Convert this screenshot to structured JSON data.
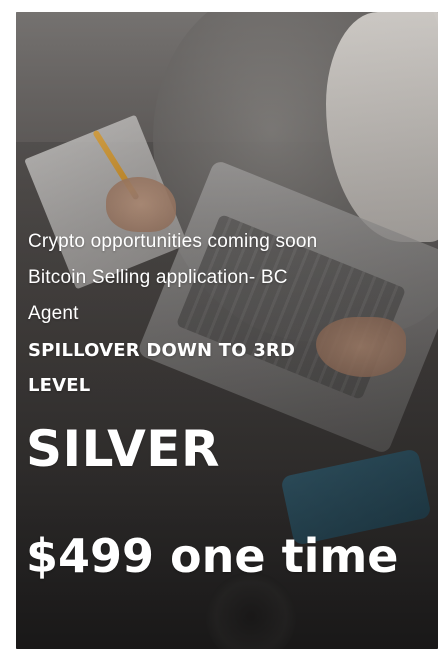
{
  "poster": {
    "lines": [
      "Crypto opportunities coming soon",
      "Bitcoin Selling application- BC",
      "Agent",
      "SPILLOVER DOWN TO 3RD",
      "LEVEL"
    ],
    "tier": "SILVER",
    "price": "$499 one time"
  },
  "colors": {
    "text": "#ffffff",
    "frame": "#ffffff"
  }
}
